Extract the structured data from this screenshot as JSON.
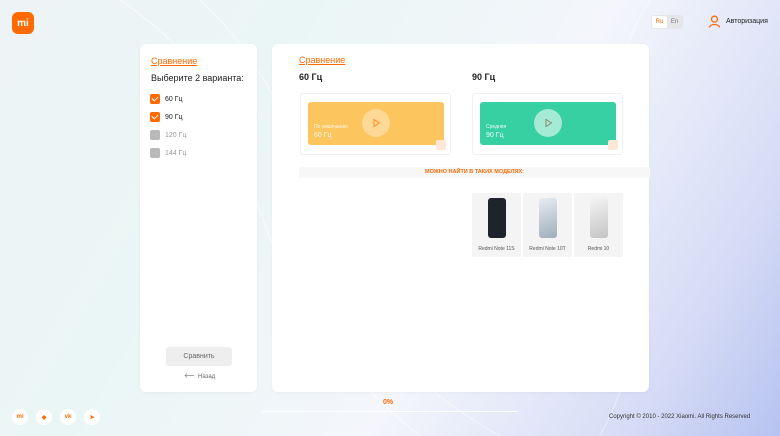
{
  "header": {
    "logo_text": "mi",
    "lang": {
      "ru": "Ru",
      "en": "En",
      "active": "Ru"
    },
    "auth_label": "Авторизация"
  },
  "left_panel": {
    "title": "Сравнение",
    "prompt": "Выберите 2 варианта:",
    "options": [
      {
        "label": "60 Гц",
        "checked": true
      },
      {
        "label": "90 Гц",
        "checked": true
      },
      {
        "label": "120 Гц",
        "checked": false
      },
      {
        "label": "144 Гц",
        "checked": false
      }
    ],
    "compare_button": "Сравнить",
    "back_label": "Назад"
  },
  "right_panel": {
    "title": "Сравнение",
    "columns": [
      {
        "heading": "60 Гц",
        "caption_small": "По умолчанию",
        "caption_value": "60 Гц",
        "color": "#fcc55d"
      },
      {
        "heading": "90 Гц",
        "caption_small": "Средняя",
        "caption_value": "90 Гц",
        "color": "#37d0a2"
      }
    ],
    "models_label": "МОЖНО НАЙТИ В ТАКИХ МОДЕЛЯХ:",
    "models": [
      {
        "name": "Redmi Note 11S",
        "color": "#1f232b"
      },
      {
        "name": "Redmi Note 10T",
        "color": "#b9c3cc"
      },
      {
        "name": "Redmi 10",
        "color": "#d8d8d8"
      }
    ]
  },
  "progress": {
    "text": "0%",
    "value": 0
  },
  "footer": {
    "social": [
      {
        "icon": "mi-icon",
        "glyph": "mi"
      },
      {
        "icon": "fox-icon",
        "glyph": "◆"
      },
      {
        "icon": "vk-icon",
        "glyph": "vk"
      },
      {
        "icon": "telegram-icon",
        "glyph": "➤"
      }
    ],
    "copyright": "Copyright © 2010 - 2022 Xiaomi. All Rights Reserved"
  },
  "colors": {
    "accent": "#ff6900"
  }
}
